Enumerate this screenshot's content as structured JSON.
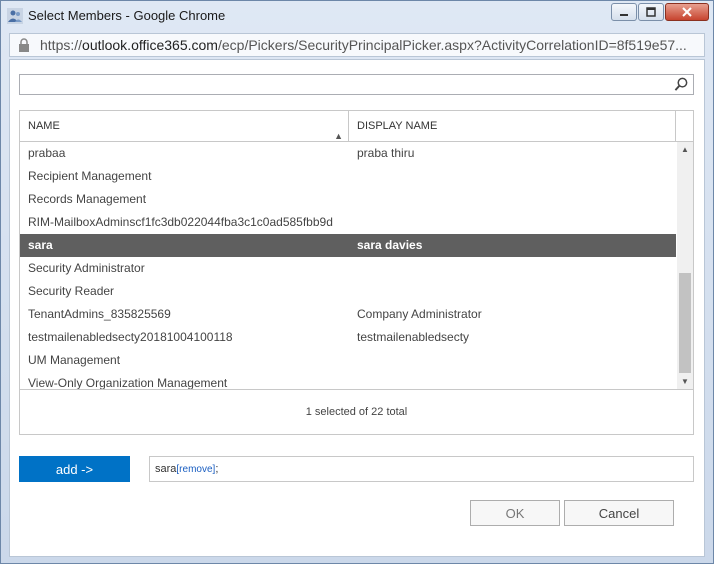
{
  "window": {
    "title": "Select Members - Google Chrome",
    "url_prefix": "https://",
    "url_host": "outlook.office365.com",
    "url_path": "/ecp/Pickers/SecurityPrincipalPicker.aspx?ActivityCorrelationID=8f519e57...",
    "minimize_icon": "minimize-icon",
    "maximize_icon": "maximize-icon",
    "close_icon": "close-icon"
  },
  "search": {
    "value": "",
    "placeholder": "",
    "icon": "search-icon"
  },
  "grid": {
    "columns": {
      "name": "NAME",
      "display_name": "DISPLAY NAME",
      "sort_indicator": "▲"
    },
    "rows": [
      {
        "name": "prabaa",
        "display_name": "praba thiru",
        "selected": false
      },
      {
        "name": "Recipient Management",
        "display_name": "",
        "selected": false
      },
      {
        "name": "Records Management",
        "display_name": "",
        "selected": false
      },
      {
        "name": "RIM-MailboxAdminscf1fc3db022044fba3c1c0ad585fbb9d",
        "display_name": "",
        "selected": false
      },
      {
        "name": "sara",
        "display_name": "sara davies",
        "selected": true
      },
      {
        "name": "Security Administrator",
        "display_name": "",
        "selected": false
      },
      {
        "name": "Security Reader",
        "display_name": "",
        "selected": false
      },
      {
        "name": "TenantAdmins_835825569",
        "display_name": "Company Administrator",
        "selected": false
      },
      {
        "name": "testmailenabledsecty20181004100118",
        "display_name": "testmailenabledsecty",
        "selected": false
      },
      {
        "name": "UM Management",
        "display_name": "",
        "selected": false
      },
      {
        "name": "View-Only Organization Management",
        "display_name": "",
        "selected": false
      }
    ],
    "footer": "1 selected of 22 total"
  },
  "add_button": {
    "label": "add ->"
  },
  "selection": {
    "name": "sara",
    "remove_label": "[remove]",
    "separator": ";"
  },
  "buttons": {
    "ok": "OK",
    "cancel": "Cancel"
  },
  "colors": {
    "accent": "#0072c6",
    "selected_row": "#5f5f5f"
  }
}
